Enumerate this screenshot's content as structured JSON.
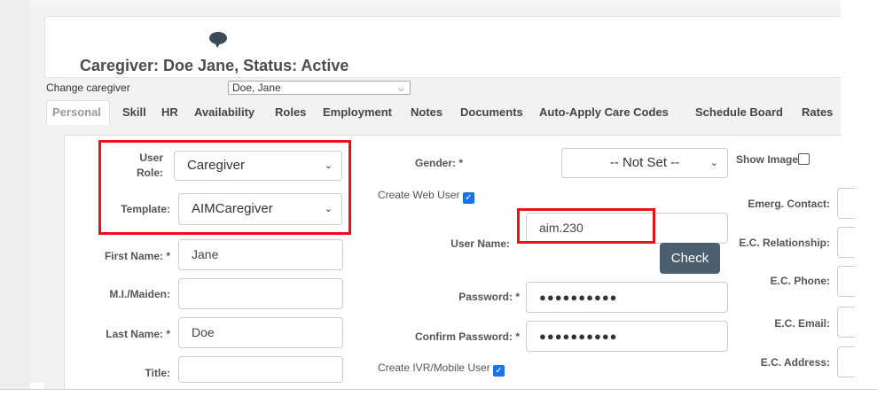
{
  "header": {
    "title": "Caregiver: Doe Jane, Status: Active",
    "change_label": "Change caregiver",
    "caregiver_select_value": "Doe, Jane"
  },
  "tabs": [
    {
      "label": "Personal",
      "active": true
    },
    {
      "label": "Skill"
    },
    {
      "label": "HR"
    },
    {
      "label": "Availability"
    },
    {
      "label": "Roles"
    },
    {
      "label": "Employment"
    },
    {
      "label": "Notes"
    },
    {
      "label": "Documents"
    },
    {
      "label": "Auto-Apply Care Codes"
    },
    {
      "label": "Schedule Board"
    },
    {
      "label": "Rates"
    }
  ],
  "form": {
    "user_role": {
      "label_line1": "User",
      "label_line2": "Role:",
      "value": "Caregiver"
    },
    "template": {
      "label": "Template:",
      "value": "AIMCaregiver"
    },
    "first_name": {
      "label": "First Name: *",
      "value": "Jane"
    },
    "mi_maiden": {
      "label": "M.I./Maiden:",
      "value": ""
    },
    "last_name": {
      "label": "Last Name: *",
      "value": "Doe"
    },
    "title": {
      "label": "Title:",
      "value": ""
    },
    "gender": {
      "label": "Gender: *",
      "value": "-- Not Set --"
    },
    "create_web_user": {
      "label": "Create Web User",
      "checked": true
    },
    "user_name": {
      "label": "User Name:",
      "value": "aim.230"
    },
    "check_button": "Check",
    "password": {
      "label": "Password: *",
      "value": "●●●●●●●●●●"
    },
    "confirm_password": {
      "label": "Confirm Password: *",
      "value": "●●●●●●●●●●"
    },
    "create_ivr_user": {
      "label": "Create IVR/Mobile User",
      "checked": true
    },
    "show_image": {
      "label": "Show Image",
      "checked": false
    },
    "emerg_contact": {
      "label": "Emerg. Contact:"
    },
    "ec_relationship": {
      "label": "E.C. Relationship:"
    },
    "ec_phone": {
      "label": "E.C. Phone:"
    },
    "ec_email": {
      "label": "E.C. Email:"
    },
    "ec_address": {
      "label": "E.C. Address:"
    }
  },
  "colors": {
    "highlight_red": "#ee1111",
    "checkbox_blue": "#1a73e8",
    "button_slate": "#4b5f6e"
  }
}
